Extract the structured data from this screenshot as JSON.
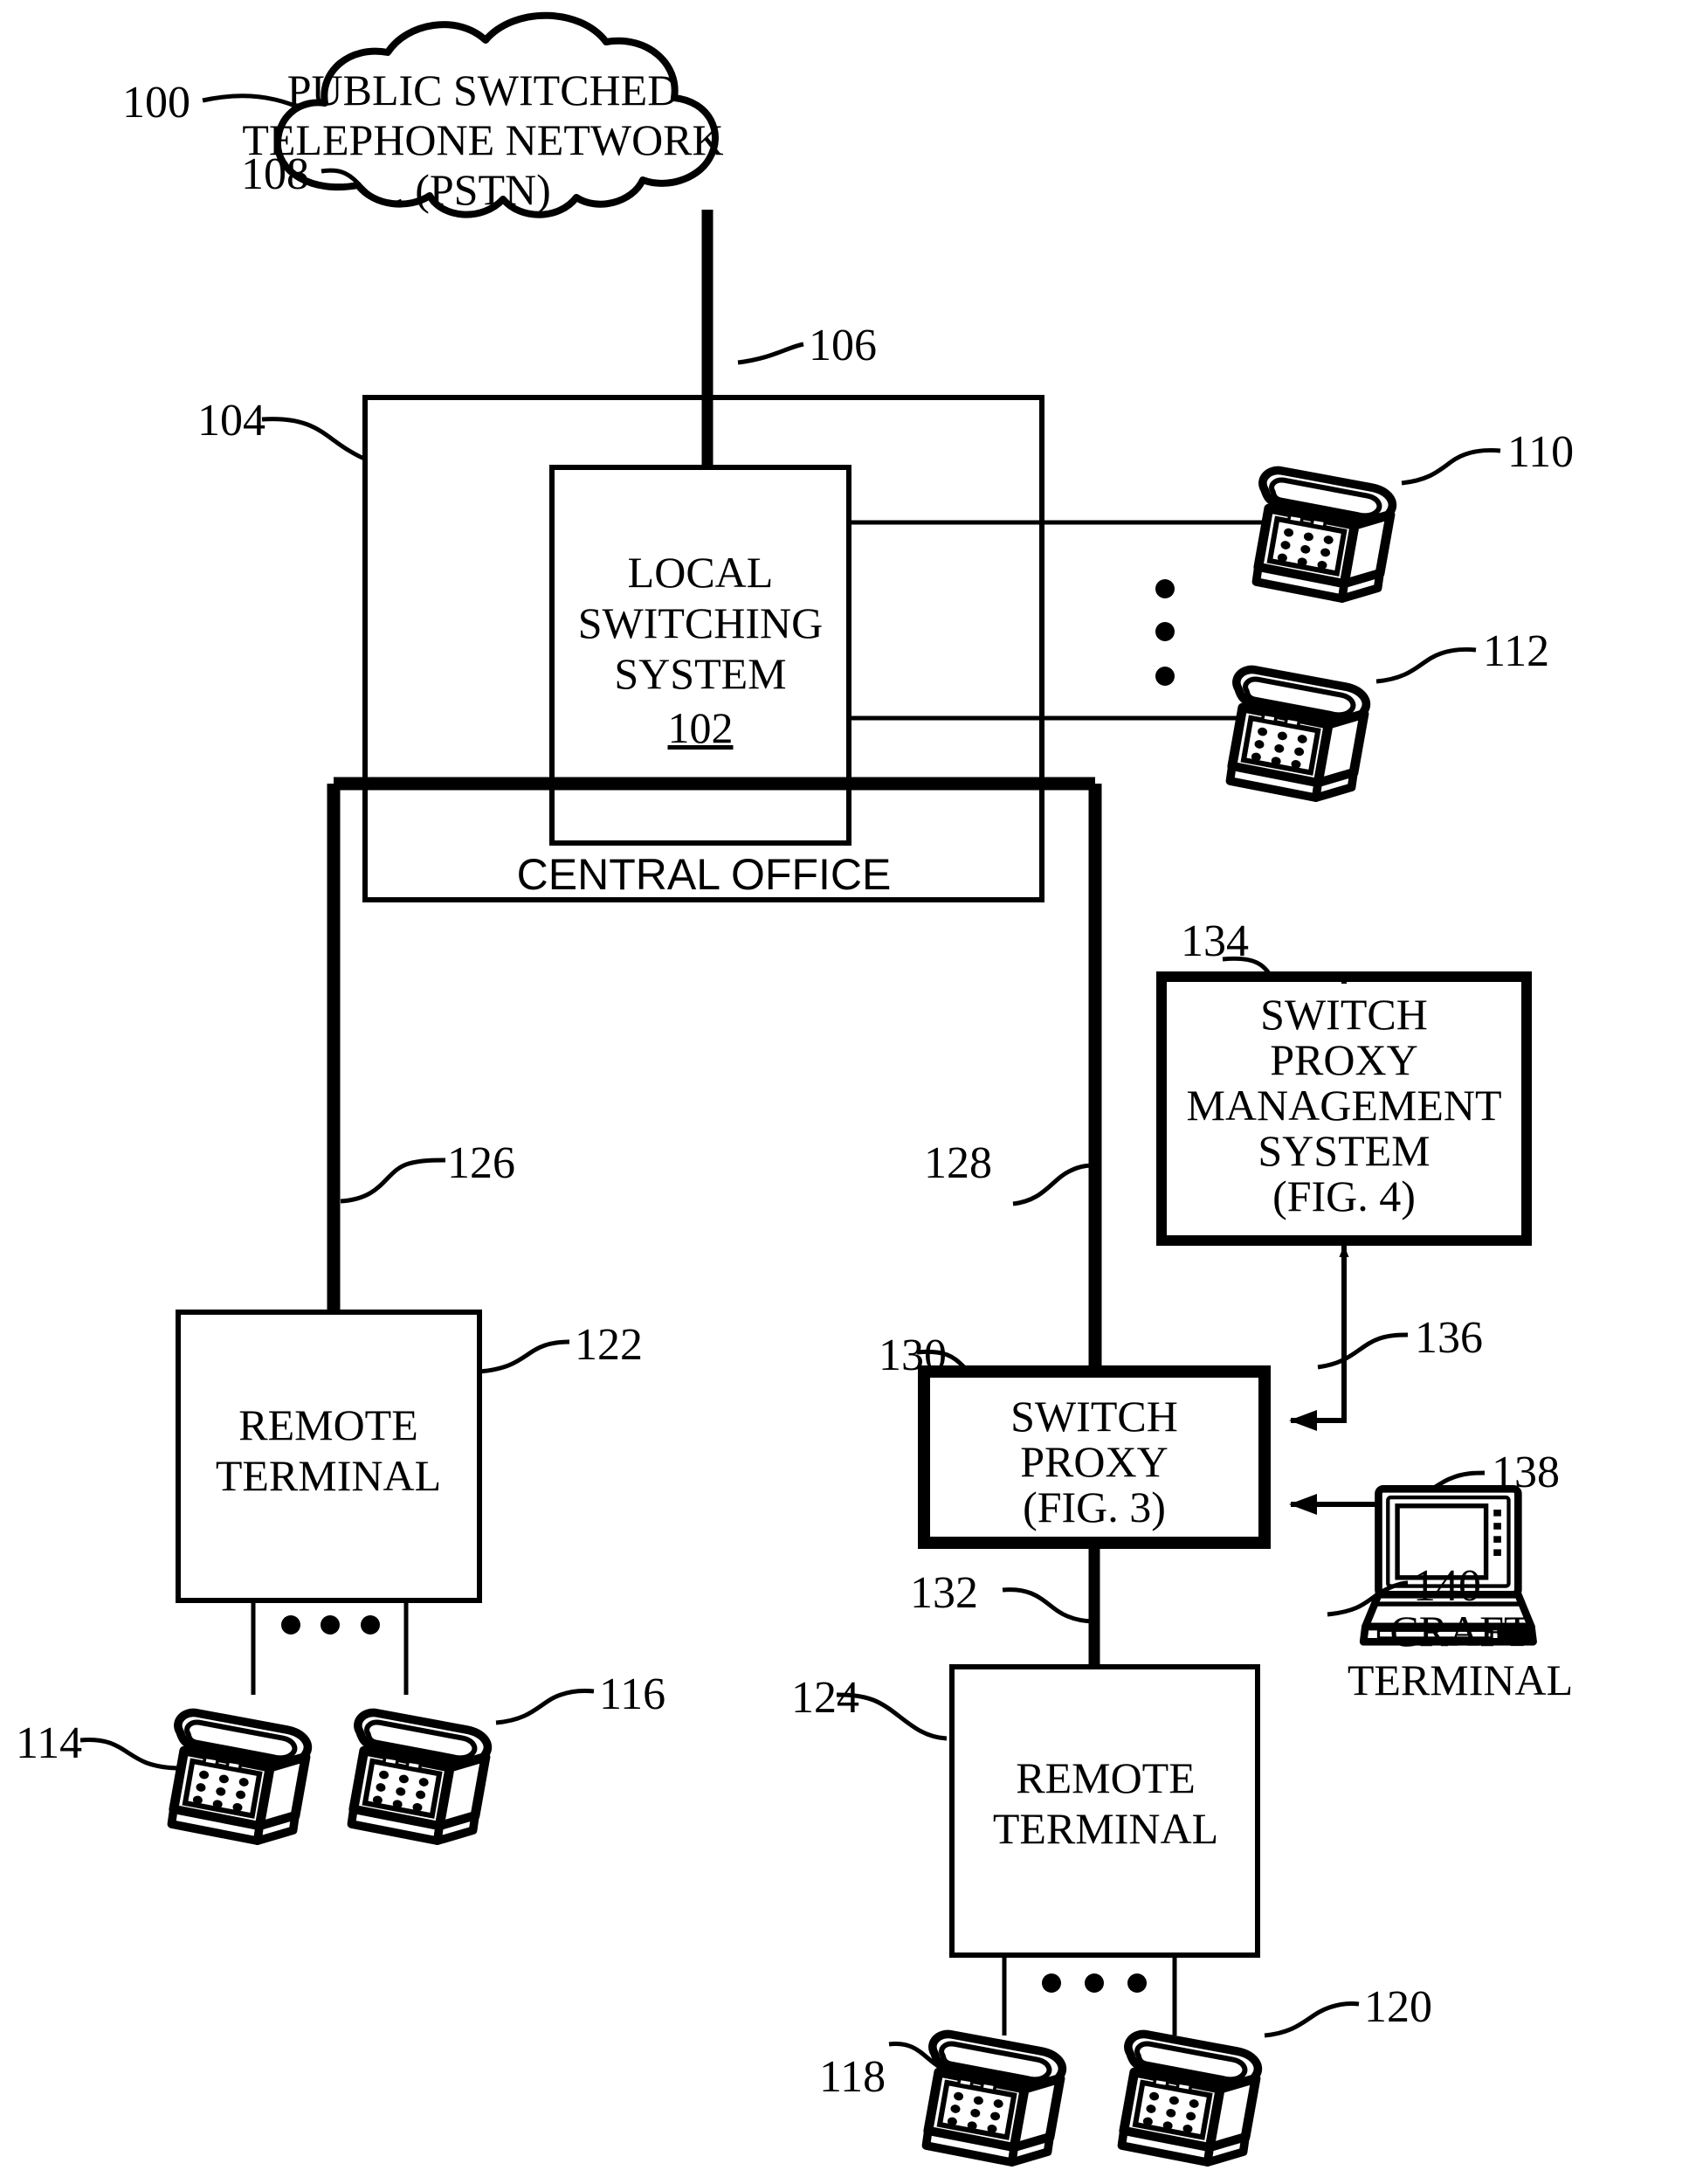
{
  "figure": {
    "ref_main": "100",
    "nodes": {
      "pstn": {
        "ref": "108",
        "lines": [
          "PUBLIC SWITCHED",
          "TELEPHONE NETWORK",
          "(PSTN)"
        ]
      },
      "central_office": {
        "ref": "104",
        "label": "CENTRAL OFFICE"
      },
      "local_switching_system": {
        "lines": [
          "LOCAL",
          "SWITCHING",
          "SYSTEM"
        ],
        "ref_inside": "102"
      },
      "switch_proxy_management_system": {
        "ref": "134",
        "lines": [
          "SWITCH",
          "PROXY",
          "MANAGEMENT",
          "SYSTEM",
          "(FIG. 4)"
        ]
      },
      "switch_proxy": {
        "ref": "130",
        "lines": [
          "SWITCH",
          "PROXY",
          "(FIG. 3)"
        ]
      },
      "remote_terminal_left": {
        "ref": "122",
        "lines": [
          "REMOTE",
          "TERMINAL"
        ]
      },
      "remote_terminal_bottom": {
        "ref": "124",
        "lines": [
          "REMOTE",
          "TERMINAL"
        ]
      },
      "craft_terminal": {
        "ref": "140",
        "lines": [
          "CRAFT",
          "TERMINAL"
        ]
      }
    },
    "telephones": [
      {
        "ref": "110",
        "name": "telephone-110"
      },
      {
        "ref": "112",
        "name": "telephone-112"
      },
      {
        "ref": "114",
        "name": "telephone-114"
      },
      {
        "ref": "116",
        "name": "telephone-116"
      },
      {
        "ref": "118",
        "name": "telephone-118"
      },
      {
        "ref": "120",
        "name": "telephone-120"
      }
    ],
    "links": [
      {
        "ref": "106",
        "name": "link-pstn-to-central-office"
      },
      {
        "ref": "126",
        "name": "link-central-office-to-remote-terminal-left"
      },
      {
        "ref": "128",
        "name": "link-central-office-to-switch-proxy"
      },
      {
        "ref": "132",
        "name": "link-switch-proxy-to-remote-terminal-bottom"
      },
      {
        "ref": "136",
        "name": "link-spms-to-switch-proxy"
      },
      {
        "ref": "138",
        "name": "link-craft-terminal-to-switch-proxy"
      }
    ],
    "colors": {
      "ink": "#000000",
      "paper": "#ffffff"
    }
  }
}
